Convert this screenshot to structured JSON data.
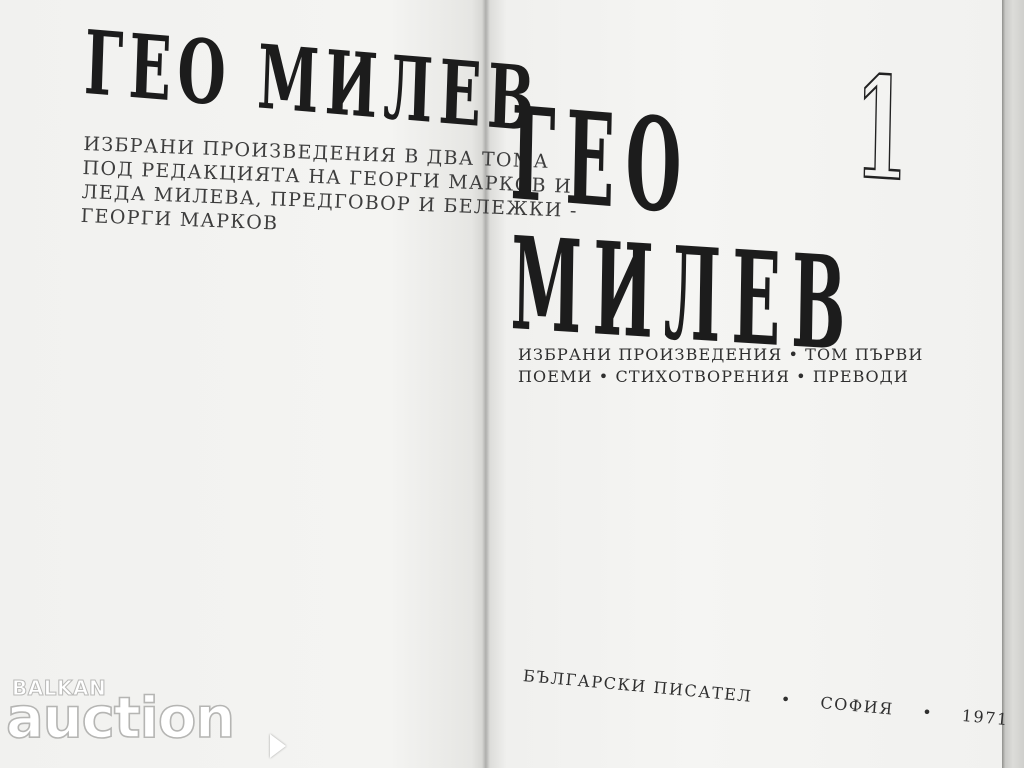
{
  "left_page": {
    "title": "ГЕО МИЛЕВ",
    "subtitle_lines": [
      "ИЗБРАНИ ПРОИЗВЕДЕНИЯ В ДВА ТОМА",
      "ПОД РЕДАКЦИЯТА НА ГЕОРГИ МАРКОВ И",
      "ЛЕДА МИЛЕВА, ПРЕДГОВОР И БЕЛЕЖКИ -",
      "ГЕОРГИ МАРКОВ"
    ]
  },
  "right_page": {
    "title_line1": "ГЕО",
    "title_line2": "МИЛЕВ",
    "volume_number": "1",
    "subtitle_line1": "ИЗБРАНИ ПРОИЗВЕДЕНИЯ • ТОМ ПЪРВИ",
    "subtitle_line2": "ПОЕМИ • СТИХОТВОРЕНИЯ • ПРЕВОДИ",
    "imprint": {
      "publisher": "БЪЛГАРСКИ ПИСАТЕЛ",
      "city": "СОФИЯ",
      "year": "1971",
      "separator": "•"
    }
  },
  "watermark": {
    "small": "BALKAN",
    "big": "auction",
    "icon": "play-arrow-icon"
  }
}
